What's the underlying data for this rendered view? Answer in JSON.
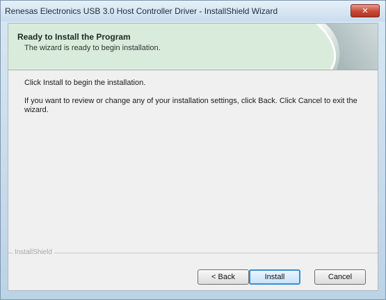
{
  "window": {
    "title": "Renesas Electronics USB 3.0 Host Controller Driver - InstallShield Wizard",
    "close_label": "✕"
  },
  "header": {
    "title": "Ready to Install the Program",
    "subtitle": "The wizard is ready to begin installation."
  },
  "body": {
    "line1": "Click Install to begin the installation.",
    "line2": "If you want to review or change any of your installation settings, click Back. Click Cancel to exit the wizard."
  },
  "footer": {
    "brand": "InstallShield"
  },
  "buttons": {
    "back": "< Back",
    "install": "Install",
    "cancel": "Cancel"
  }
}
